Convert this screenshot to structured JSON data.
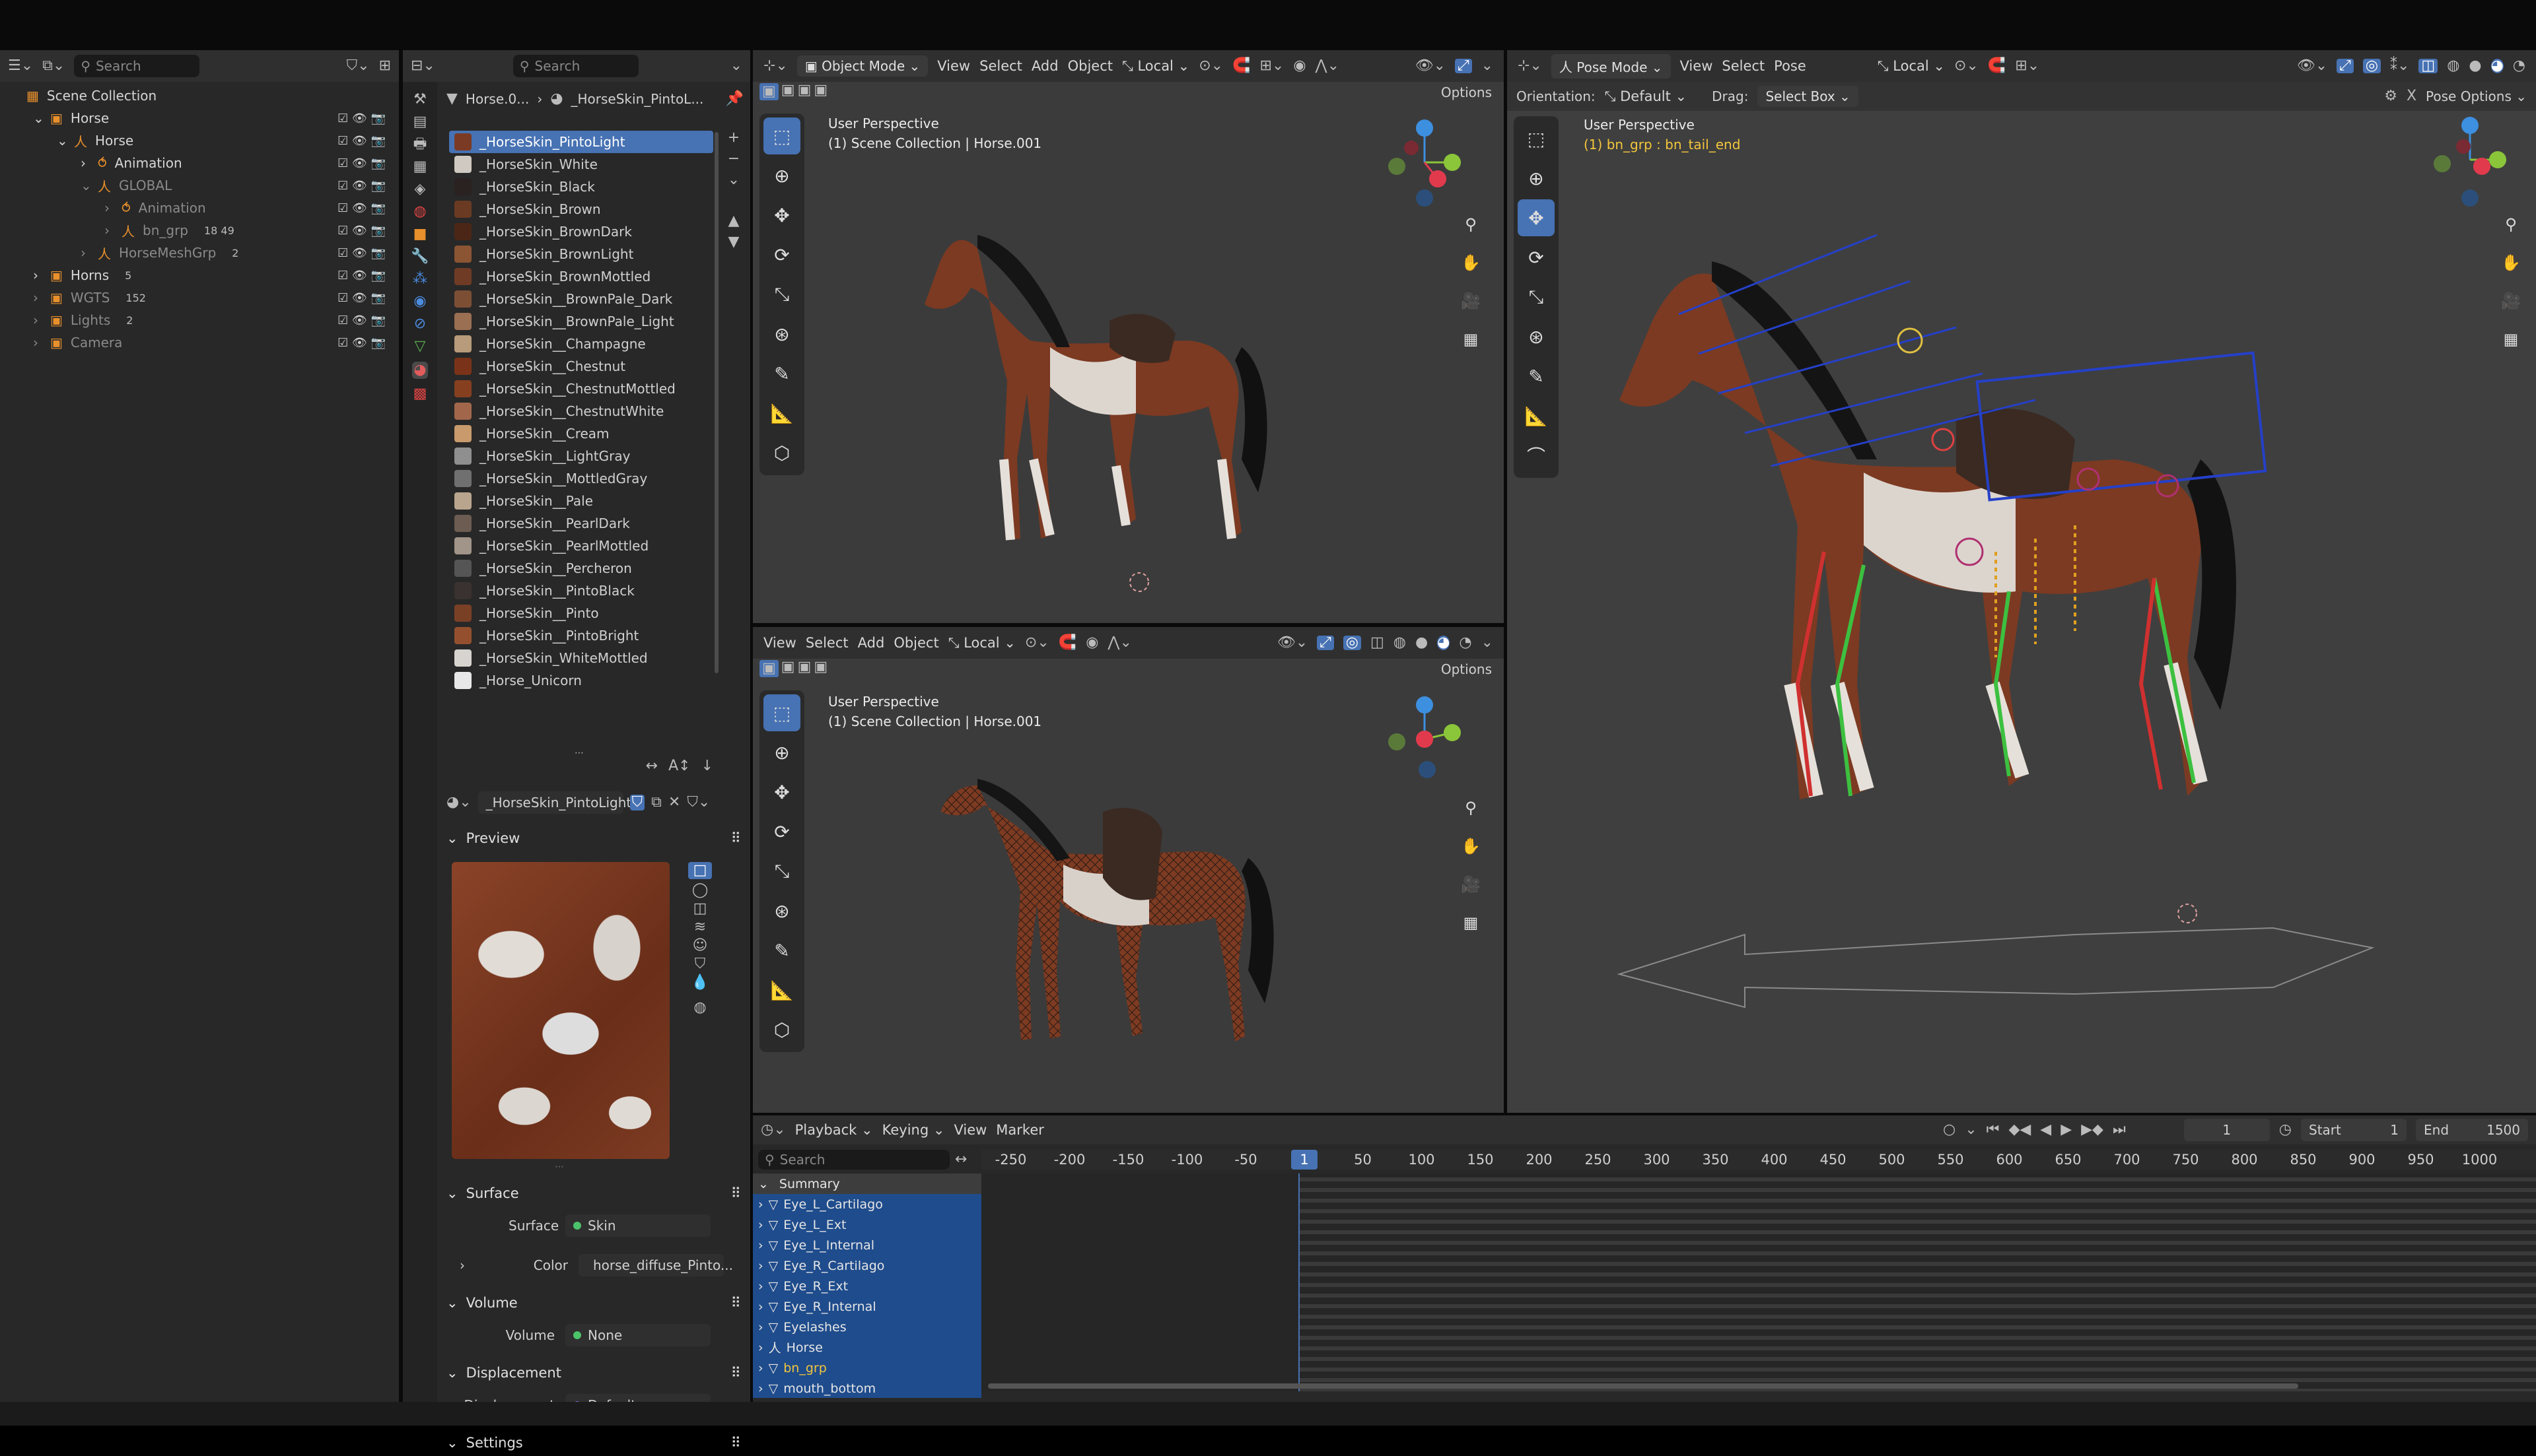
{
  "outliner": {
    "search_placeholder": "Search",
    "rows": [
      {
        "label": "Scene Collection",
        "indent": 0,
        "arrow": "",
        "color": "#d6d6d6",
        "icon": "▦"
      },
      {
        "label": "Horse",
        "indent": 1,
        "arrow": "⌄",
        "color": "#d6d6d6",
        "icon": "▣"
      },
      {
        "label": "Horse",
        "indent": 2,
        "arrow": "⌄",
        "color": "#d6d6d6",
        "icon": "人"
      },
      {
        "label": "Animation",
        "indent": 3,
        "arrow": "›",
        "color": "#d6d6d6",
        "icon": "⥀"
      },
      {
        "label": "GLOBAL",
        "indent": 3,
        "arrow": "⌄",
        "color": "#8a8a8a",
        "icon": "人"
      },
      {
        "label": "Animation",
        "indent": 4,
        "arrow": "›",
        "color": "#8a8a8a",
        "icon": "⥀"
      },
      {
        "label": "bn_grp",
        "indent": 4,
        "arrow": "›",
        "color": "#8a8a8a",
        "icon": "人",
        "extra": "18  49"
      },
      {
        "label": "HorseMeshGrp",
        "indent": 3,
        "arrow": "›",
        "color": "#8a8a8a",
        "icon": "人",
        "extra": "2"
      },
      {
        "label": "Horns",
        "indent": 1,
        "arrow": "›",
        "color": "#d6d6d6",
        "icon": "▣",
        "extra": "5"
      },
      {
        "label": "WGTS",
        "indent": 1,
        "arrow": "›",
        "color": "#8a8a8a",
        "icon": "▣",
        "extra": "152"
      },
      {
        "label": "Lights",
        "indent": 1,
        "arrow": "›",
        "color": "#8a8a8a",
        "icon": "▣",
        "extra": "2"
      },
      {
        "label": "Camera",
        "indent": 1,
        "arrow": "›",
        "color": "#8a8a8a",
        "icon": "▣"
      }
    ]
  },
  "material_panel": {
    "breadcrumb_object": "Horse.0...",
    "breadcrumb_material": "_HorseSkin_PintoL...",
    "search_placeholder": "Search",
    "slots": [
      {
        "name": "_HorseSkin_PintoLight",
        "color": "#7b3a24"
      },
      {
        "name": "_HorseSkin_White",
        "color": "#cfc9c2"
      },
      {
        "name": "_HorseSkin_Black",
        "color": "#2a2220"
      },
      {
        "name": "_HorseSkin_Brown",
        "color": "#6a3a22"
      },
      {
        "name": "_HorseSkin_BrownDark",
        "color": "#4b2616"
      },
      {
        "name": "_HorseSkin_BrownLight",
        "color": "#8b5433"
      },
      {
        "name": "_HorseSkin_BrownMottled",
        "color": "#6f3b25"
      },
      {
        "name": "_HorseSkin__BrownPale_Dark",
        "color": "#7c4f35"
      },
      {
        "name": "_HorseSkin__BrownPale_Light",
        "color": "#9a6f52"
      },
      {
        "name": "_HorseSkin__Champagne",
        "color": "#b79b7a"
      },
      {
        "name": "_HorseSkin__Chestnut",
        "color": "#7a3318"
      },
      {
        "name": "_HorseSkin__ChestnutMottled",
        "color": "#86401f"
      },
      {
        "name": "_HorseSkin__ChestnutWhite",
        "color": "#a2674a"
      },
      {
        "name": "_HorseSkin__Cream",
        "color": "#c89a6c"
      },
      {
        "name": "_HorseSkin__LightGray",
        "color": "#8f8f8f"
      },
      {
        "name": "_HorseSkin__MottledGray",
        "color": "#707070"
      },
      {
        "name": "_HorseSkin__Pale",
        "color": "#b9a58e"
      },
      {
        "name": "_HorseSkin__PearlDark",
        "color": "#6c5c52"
      },
      {
        "name": "_HorseSkin__PearlMottled",
        "color": "#a19488"
      },
      {
        "name": "_HorseSkin__Percheron",
        "color": "#555"
      },
      {
        "name": "_HorseSkin__PintoBlack",
        "color": "#3a3230"
      },
      {
        "name": "_HorseSkin__Pinto",
        "color": "#7a4026"
      },
      {
        "name": "_HorseSkin__PintoBright",
        "color": "#94502e"
      },
      {
        "name": "_HorseSkin_WhiteMottled",
        "color": "#d7d3cf"
      },
      {
        "name": "_Horse_Unicorn",
        "color": "#e8e8e8"
      }
    ],
    "active_material": "_HorseSkin_PintoLight",
    "preview_label": "Preview",
    "surface_section": "Surface",
    "surface_label": "Surface",
    "surface_value": "Skin",
    "color_label": "Color",
    "color_value": "horse_diffuse_Pinto...",
    "volume_section": "Volume",
    "volume_label": "Volume",
    "volume_value": "None",
    "displacement_section": "Displacement",
    "displacement_label": "Displacement",
    "displacement_value": "Default",
    "settings_section": "Settings"
  },
  "viewport_top": {
    "mode": "Object Mode",
    "menus": [
      "View",
      "Select",
      "Add",
      "Object"
    ],
    "transform": "Local",
    "options": "Options",
    "persp_title": "User Perspective",
    "persp_sub": "(1) Scene Collection | Horse.001"
  },
  "viewport_bottom": {
    "menus": [
      "View",
      "Select",
      "Add",
      "Object"
    ],
    "transform": "Local",
    "options": "Options",
    "persp_title": "User Perspective",
    "persp_sub": "(1) Scene Collection | Horse.001"
  },
  "viewport_right": {
    "mode": "Pose Mode",
    "menus": [
      "View",
      "Select",
      "Pose"
    ],
    "transform": "Local",
    "orientation_label": "Orientation:",
    "orientation_value": "Default",
    "drag_label": "Drag:",
    "drag_value": "Select Box",
    "pose_options": "Pose Options",
    "persp_title": "User Perspective",
    "persp_sub": "(1) bn_grp : bn_tail_end"
  },
  "timeline": {
    "menus": [
      "Playback",
      "Keying",
      "View",
      "Marker"
    ],
    "current_frame": "1",
    "start_label": "Start",
    "start_value": "1",
    "end_label": "End",
    "end_value": "1500",
    "search_placeholder": "Search",
    "ruler": [
      "-250",
      "-200",
      "-150",
      "-100",
      "-50",
      "1",
      "50",
      "100",
      "150",
      "200",
      "250",
      "300",
      "350",
      "400",
      "450",
      "500",
      "550",
      "600",
      "650",
      "700",
      "750",
      "800",
      "850",
      "900",
      "950",
      "1000"
    ],
    "channels": [
      "Summary",
      "Eye_L_Cartilago",
      "Eye_L_Ext",
      "Eye_L_Internal",
      "Eye_R_Cartilago",
      "Eye_R_Ext",
      "Eye_R_Internal",
      "Eyelashes",
      "Horse",
      "bn_grp",
      "mouth_bottom"
    ]
  },
  "colors": {
    "accent": "#4772b3",
    "selected_text": "#f3c63c",
    "axis_x": "#e23a4d",
    "axis_y": "#8bc53a",
    "axis_z": "#3d8fe0"
  }
}
